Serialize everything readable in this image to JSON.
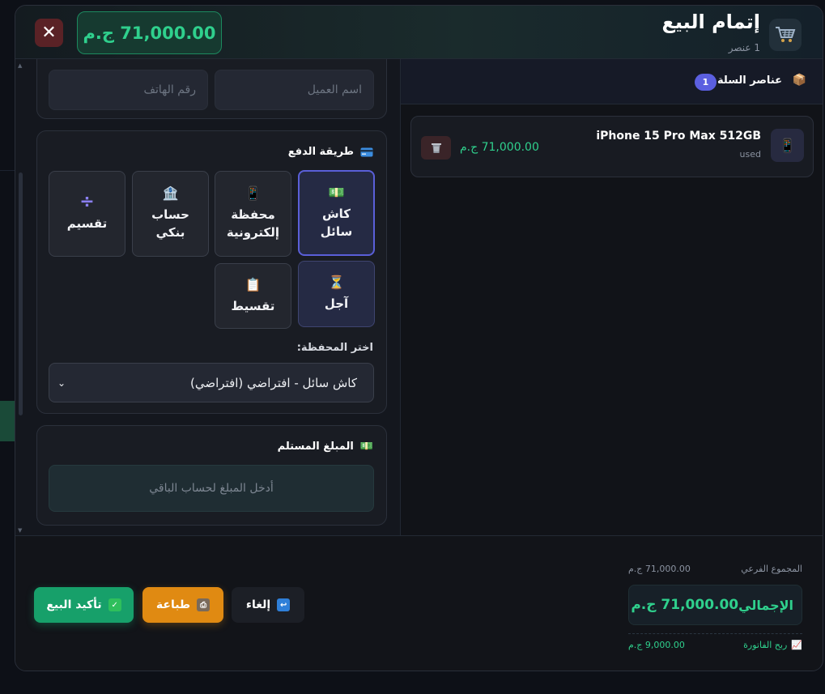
{
  "header": {
    "title": "إتمام البيع",
    "item_count": "1 عنصر",
    "total": "71,000.00 ج.م",
    "close_glyph": "✕",
    "icon": "shopping-cart-icon"
  },
  "customer": {
    "name_placeholder": "اسم العميل",
    "phone_placeholder": "رقم الهاتف"
  },
  "payment": {
    "title": "طريقة الدفع",
    "icon": "credit-card-icon",
    "methods": [
      {
        "label": "كاش سائل",
        "icon": "cash-icon",
        "glyph": "💵",
        "active": true
      },
      {
        "label": "محفظة إلكترونية",
        "icon": "mobile-wallet-icon",
        "glyph": "📱",
        "active": false
      },
      {
        "label": "حساب بنكي",
        "icon": "bank-icon",
        "glyph": "🏦",
        "active": false
      },
      {
        "label": "تقسيم",
        "icon": "divide-icon",
        "glyph": "÷",
        "active": false
      },
      {
        "label": "آجل",
        "icon": "hourglass-icon",
        "glyph": "⏳",
        "active": false
      },
      {
        "label": "تقسيط",
        "icon": "clipboard-icon",
        "glyph": "📋",
        "active": false
      }
    ],
    "wallet_label": "اختر المحفظة:",
    "wallet_selected": "كاش سائل - افتراضي (افتراضي)"
  },
  "received": {
    "title": "المبلغ المستلم",
    "icon": "cash-icon",
    "placeholder": "أدخل المبلغ لحساب الباقي"
  },
  "cart": {
    "title": "عناصر السلة",
    "count": "1",
    "icon": "package-icon",
    "items": [
      {
        "name": "iPhone 15 Pro Max 512GB",
        "condition": "used",
        "price": "71,000.00 ج.م",
        "icon": "phone-icon"
      }
    ]
  },
  "actions": {
    "confirm": "تأكيد البيع",
    "print": "طباعة",
    "cancel": "إلغاء"
  },
  "summary": {
    "subtotal_label": "المجموع الفرعي",
    "subtotal_value": "71,000.00 ج.م",
    "total_label": "الإجمالي",
    "total_value": "71,000.00 ج.م",
    "profit_label": "ربح الفاتورة",
    "profit_value": "9,000.00 ج.م"
  },
  "colors": {
    "accent_green": "#2fd08d",
    "accent_indigo": "#5b5fe0",
    "print_orange": "#e08a12",
    "close_red": "#5a2226"
  }
}
